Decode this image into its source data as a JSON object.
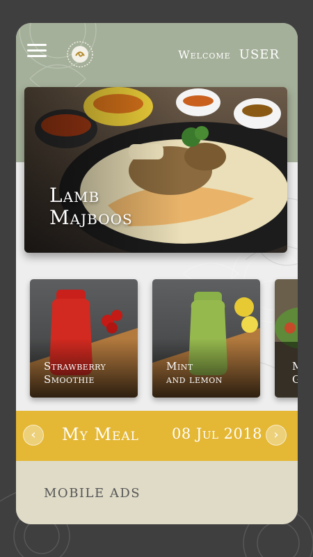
{
  "header": {
    "welcome_text": "Welcome",
    "user_text": "USER",
    "menu_icon": "hamburger-menu-icon",
    "logo_icon": "restaurant-logo-icon"
  },
  "hero": {
    "title": "Lamb\nMajboos"
  },
  "items": [
    {
      "label": "Strawberry\nSmoothie"
    },
    {
      "label": "Mint\nand lemon"
    },
    {
      "label": "M\nG"
    }
  ],
  "meal_bar": {
    "title": "My Meal",
    "date": "08 Jul 2018",
    "prev_icon": "chevron-left-icon",
    "next_icon": "chevron-right-icon"
  },
  "ads": {
    "label": "MOBILE ADS"
  },
  "colors": {
    "header_bg": "#a5b09a",
    "accent_gold": "#e4b734",
    "ads_bg": "#dfdbc7",
    "page_bg": "#3f3f3f"
  }
}
